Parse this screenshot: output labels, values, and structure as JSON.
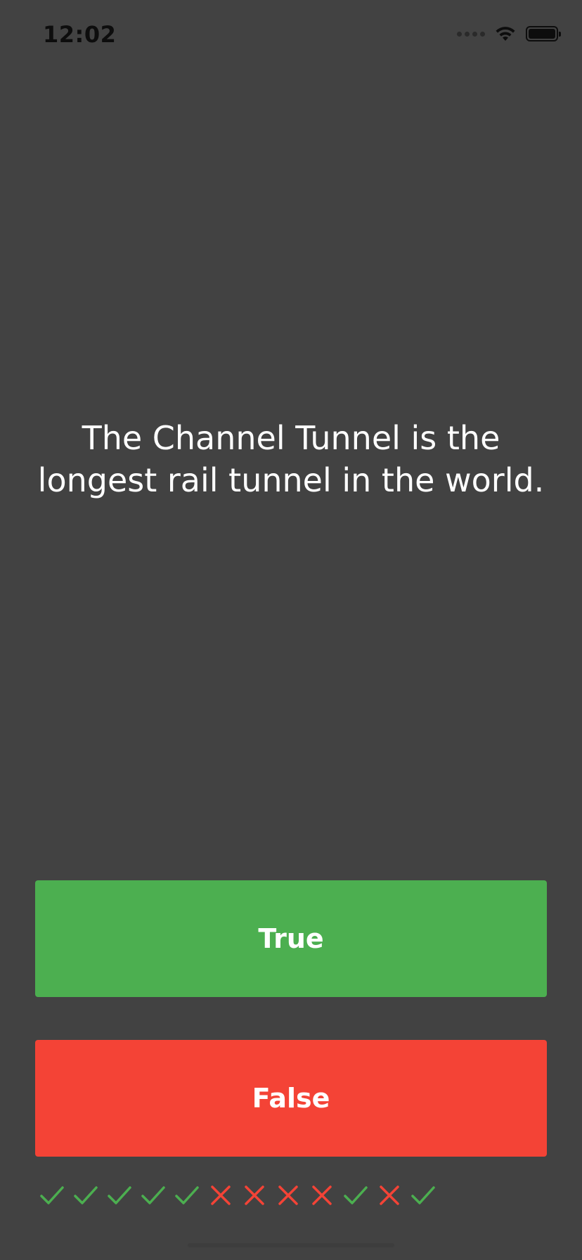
{
  "status_bar": {
    "time": "12:02",
    "text_color": "#0d0d0d"
  },
  "quiz": {
    "question": "The Channel Tunnel is the longest rail tunnel in the world.",
    "true_label": "True",
    "false_label": "False"
  },
  "score": {
    "marks": [
      "check",
      "check",
      "check",
      "check",
      "check",
      "cross",
      "cross",
      "cross",
      "cross",
      "check",
      "cross",
      "check"
    ]
  },
  "colors": {
    "background": "#424242",
    "true": "#4caf50",
    "false": "#f44336",
    "check": "#4caf50",
    "cross": "#f44336"
  }
}
